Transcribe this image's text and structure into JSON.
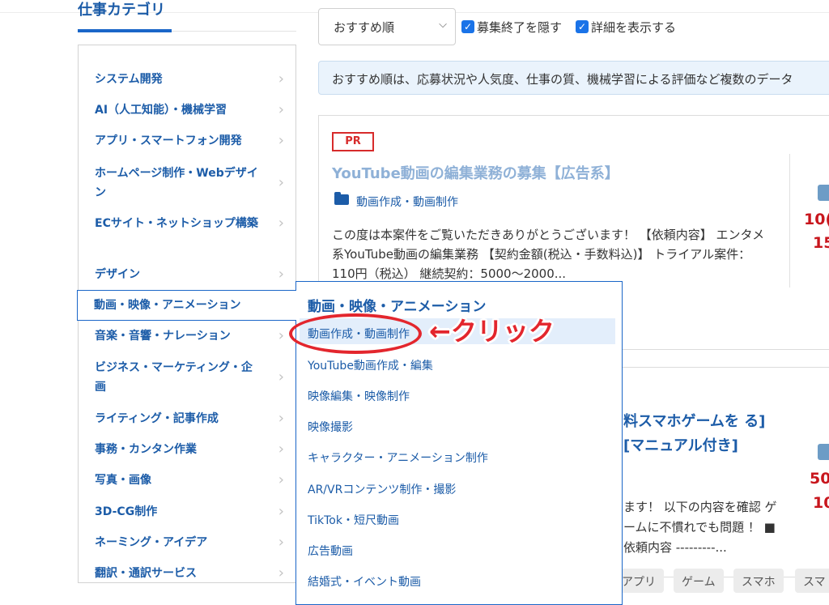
{
  "sidebar": {
    "heading": "仕事カテゴリ",
    "items": [
      {
        "label": "システム開発"
      },
      {
        "label": "AI（人工知能）・機械学習"
      },
      {
        "label": "アプリ・スマートフォン開発"
      },
      {
        "label": "ホームページ制作・Webデザイン"
      },
      {
        "label": "ECサイト・ネットショップ構築"
      },
      {
        "label": "デザイン"
      },
      {
        "label": "動画・映像・アニメーション"
      },
      {
        "label": "音楽・音響・ナレーション"
      },
      {
        "label": "ビジネス・マーケティング・企画"
      },
      {
        "label": "ライティング・記事作成"
      },
      {
        "label": "事務・カンタン作業"
      },
      {
        "label": "写真・画像"
      },
      {
        "label": "3D-CG制作"
      },
      {
        "label": "ネーミング・アイデア"
      },
      {
        "label": "翻訳・通訳サービス"
      }
    ],
    "chevron": "›"
  },
  "subcategory": {
    "title": "動画・映像・アニメーション",
    "items": [
      {
        "label": "動画作成・動画制作"
      },
      {
        "label": "YouTube動画作成・編集"
      },
      {
        "label": "映像編集・映像制作"
      },
      {
        "label": "映像撮影"
      },
      {
        "label": "キャラクター・アニメーション制作"
      },
      {
        "label": "AR/VRコンテンツ制作・撮影"
      },
      {
        "label": "TikTok・短尺動画"
      },
      {
        "label": "広告動画"
      },
      {
        "label": "結婚式・イベント動画"
      }
    ]
  },
  "annotation": {
    "label": "←クリック",
    "color": "#e3262d"
  },
  "controls": {
    "sort_value": "おすすめ順",
    "sort_caret": "⌵",
    "hide_closed_label": "募集終了を隠す",
    "show_details_label": "詳細を表示する",
    "check_mark": "✓"
  },
  "info_bar": {
    "text": "おすすめ順は、応募状況や人気度、仕事の質、機械学習による評価など複数のデータ"
  },
  "jobs": [
    {
      "badge": "PR",
      "title": "YouTube動画の編集業務の募集【広告系】",
      "category": "動画作成・動画制作",
      "description": "この度は本案件をご覧いただきありがとうございます！ 【依頼内容】 エンタメ系YouTube動画の編集業務 【契約金額(税込・手数料込)】 トライアル案件：110円（税込） 継続契約：5000〜2000...",
      "price_line1": "10(",
      "price_line2": "15"
    },
    {
      "title": "料スマホゲームを る][マニュアル付き]",
      "description": "ます！ 以下の内容を確認 ゲームに不慣れでも問題 ！ ■依頼内容 ---------...",
      "price_line1": "50",
      "price_line2": "10"
    }
  ],
  "bottom_tags": [
    "アプリ",
    "ゲーム",
    "スマホ",
    "スマ"
  ],
  "colors": {
    "accent": "#1a66c8",
    "link": "#1c5ca8",
    "price": "#c8161d"
  }
}
